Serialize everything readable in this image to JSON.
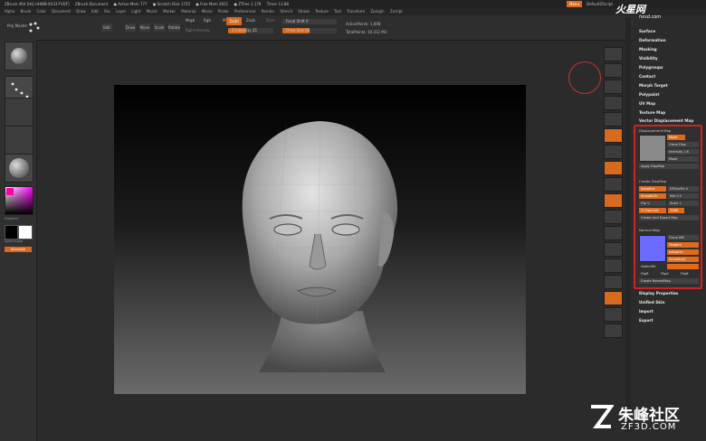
{
  "titlebar": {
    "items": [
      "ZBrush 4R4 [HQ-UHWB-XX33-TVDF]",
      "ZBrush Document",
      "● Active Mem 777",
      "● Scratch Disk 1725",
      "● Free Mem 2651",
      "● ZTime 1.176",
      "Timer 13.88"
    ],
    "menu_button": "Menu",
    "default_script": "DefaultZScript"
  },
  "menubar": [
    "Alpha",
    "Brush",
    "Color",
    "Document",
    "Draw",
    "Edit",
    "File",
    "Layer",
    "Light",
    "Macro",
    "Marker",
    "Material",
    "Movie",
    "Picker",
    "Preferences",
    "Render",
    "Stencil",
    "Stroke",
    "Texture",
    "Tool",
    "Transform",
    "Zplugin",
    "Zscript"
  ],
  "toolbar": {
    "proj_label": "Proj Master",
    "edit": "Edit",
    "draw": "Draw",
    "move": "Move",
    "scale": "Scale",
    "rotate": "Rotate",
    "mrgb": "Mrgb",
    "rgb": "Rgb",
    "m": "M",
    "rgb_intensity": "Rgb Intensity",
    "zadd": "Zadd",
    "zsub": "Zsub",
    "zcut": "Zcut",
    "z_intensity": "Z Intensity 25",
    "focal_shift": "Focal Shift 0",
    "draw_size": "Draw Size 64",
    "active_points": "ActivePoints: 1,608",
    "total_points": "TotalPoints: 10.312 Mil"
  },
  "leftshelf": {
    "gradient": "Gradient",
    "switchcolor": "SwitchColor",
    "alternate": "Alternate"
  },
  "right_tray": [
    "Surface",
    "Deformation",
    "Masking",
    "Visibility",
    "Polygroups",
    "Contact",
    "Morph Target",
    "Polypaint",
    "UV Map",
    "Texture Map",
    "Vector Displacement Map"
  ],
  "right_tray_after": [
    "Display Properties",
    "Unified Skin",
    "Import",
    "Export"
  ],
  "displacement": {
    "header": "Displacement Map",
    "dpsubpix": "DPSubPix 0",
    "mid": "Mid 0.5",
    "scale": "Scale 1",
    "intensity": "Intensity 2.6",
    "mode": "Mode",
    "clone": "Clone Disp",
    "create_disp": "Create DispMap",
    "apply": "Apply DispMap",
    "adaptive": "Adaptive",
    "smooth_uv": "SmoothUV",
    "flip_v": "Flip V",
    "channels": "3 Channels",
    "thirty_two": "32Bit",
    "create_export": "Create And Export Map"
  },
  "normal": {
    "header": "Normal Map",
    "clone": "Clone NM",
    "tangent": "Tangent",
    "adaptive": "Adaptive",
    "smooth_uv": "SmoothUV",
    "switch_rg": "SwitchRG",
    "flip_r": "FlipR",
    "flip_g": "FlipG",
    "flip_b": "FlipB",
    "create": "Create NormalMap"
  },
  "watermarks": {
    "top_cn": "火星网",
    "top_url": "hxsd.com",
    "bottom_cn": "朱峰社区",
    "bottom_url": "ZF3D.COM"
  }
}
